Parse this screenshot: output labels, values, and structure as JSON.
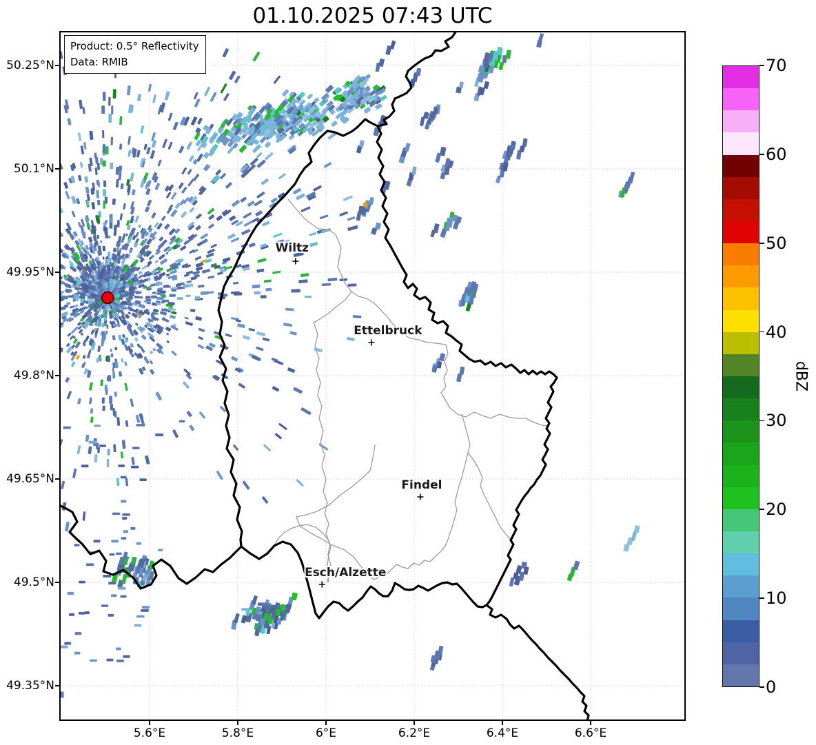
{
  "title": "01.10.2025 07:43 UTC",
  "info_box": {
    "line1": "Product: 0.5° Reflectivity",
    "line2": "Data: RMIB"
  },
  "map": {
    "lat_ticks": [
      {
        "label": "50.25°N",
        "value": 50.25
      },
      {
        "label": "50.1°N",
        "value": 50.1
      },
      {
        "label": "49.95°N",
        "value": 49.95
      },
      {
        "label": "49.8°N",
        "value": 49.8
      },
      {
        "label": "49.65°N",
        "value": 49.65
      },
      {
        "label": "49.5°N",
        "value": 49.5
      },
      {
        "label": "49.35°N",
        "value": 49.35
      }
    ],
    "lon_ticks": [
      {
        "label": "5.6°E",
        "value": 5.6
      },
      {
        "label": "5.8°E",
        "value": 5.8
      },
      {
        "label": "6°E",
        "value": 6.0
      },
      {
        "label": "6.2°E",
        "value": 6.2
      },
      {
        "label": "6.4°E",
        "value": 6.4
      },
      {
        "label": "6.6°E",
        "value": 6.6
      }
    ],
    "cities": [
      {
        "name": "Wiltz",
        "lon": 5.931,
        "lat": 49.966,
        "label_dx": -5,
        "label_dy": -19
      },
      {
        "name": "Ettelbruck",
        "lon": 6.103,
        "lat": 49.848,
        "label_dx": 24,
        "label_dy": -17
      },
      {
        "name": "Findel",
        "lon": 6.214,
        "lat": 49.624,
        "label_dx": 2,
        "label_dy": -17
      },
      {
        "name": "Esch/Alzette",
        "lon": 5.991,
        "lat": 49.497,
        "label_dx": 34,
        "label_dy": -17
      }
    ],
    "radar_station": {
      "lon": 5.505,
      "lat": 49.913,
      "dot_color": "#e8000b",
      "edge_color": "#550000"
    },
    "grid_color": "#c9c9c9",
    "country_border_color": "#000000",
    "region_border_color": "#9a9a9a"
  },
  "colorbar": {
    "label": "dBZ",
    "tick_labels": [
      "0",
      "10",
      "20",
      "30",
      "40",
      "50",
      "60",
      "70"
    ],
    "tick_values": [
      0,
      10,
      20,
      30,
      40,
      50,
      60,
      70
    ],
    "vmin": 0,
    "vmax": 70,
    "segment_step": 2.5,
    "colors": [
      "#6477ac",
      "#4f64a5",
      "#3a5da6",
      "#4f86bf",
      "#5b9fd0",
      "#62bede",
      "#5fcfae",
      "#44c877",
      "#1fc11f",
      "#1cb21c",
      "#1ba51b",
      "#1c941c",
      "#17811c",
      "#156a1e",
      "#538426",
      "#bcbe00",
      "#fee000",
      "#fdc100",
      "#fb9b00",
      "#f97d00",
      "#e00400",
      "#c51000",
      "#a50c00",
      "#720000",
      "#fce7fa",
      "#f9aef9",
      "#f763f7",
      "#e32ee3"
    ]
  }
}
